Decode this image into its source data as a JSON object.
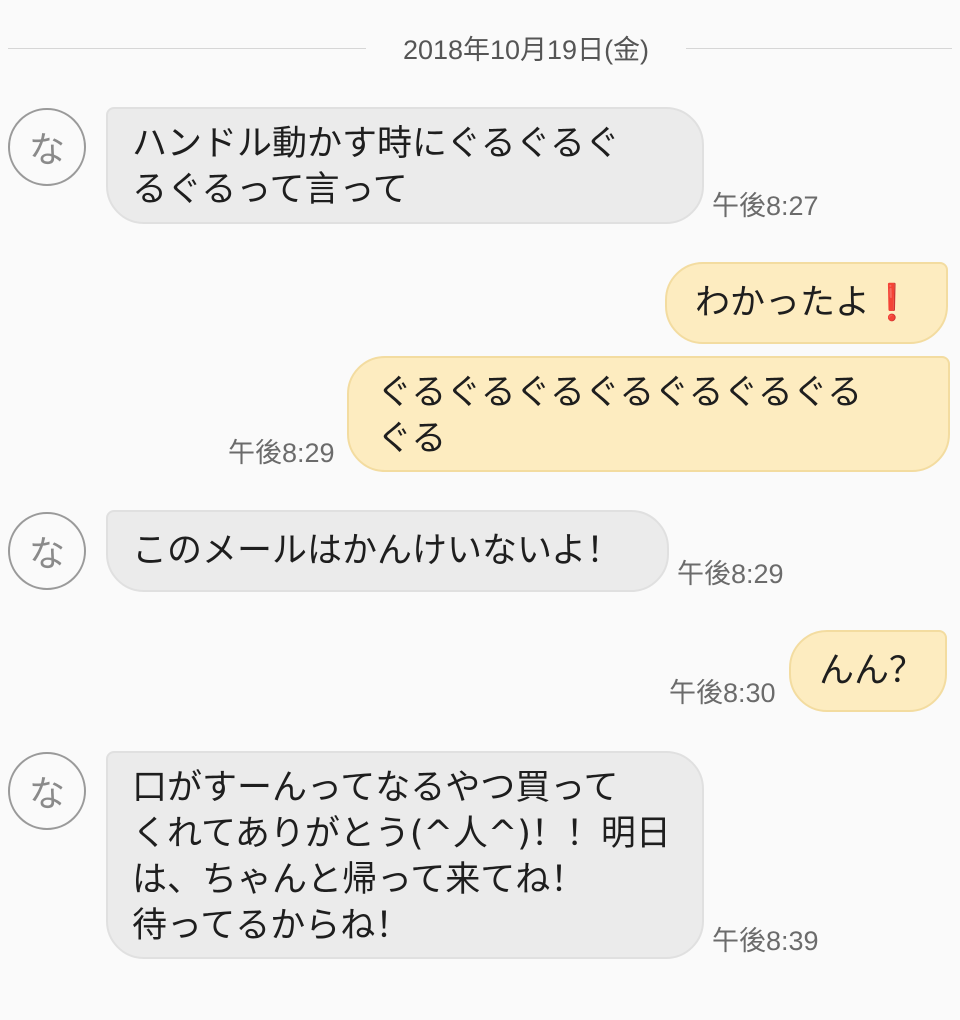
{
  "date_header": "2018年10月19日(金)",
  "avatar_label": "な",
  "messages": [
    {
      "side": "in",
      "lines": [
        "ハンドル動かす時にぐるぐるぐ",
        "るぐるって言って"
      ],
      "time": "午後8:27"
    },
    {
      "side": "out",
      "text": "わかったよ",
      "emoji": "❗"
    },
    {
      "side": "out",
      "lines": [
        "ぐるぐるぐるぐるぐるぐるぐる",
        "ぐる"
      ],
      "time": "午後8:29"
    },
    {
      "side": "in",
      "lines": [
        "このメールはかんけいないよ！"
      ],
      "time": "午後8:29"
    },
    {
      "side": "out",
      "lines": [
        "んん？"
      ],
      "time": "午後8:30"
    },
    {
      "side": "in",
      "lines": [
        "口がすーんってなるやつ買って",
        "くれてありがとう(^人^)！！明日",
        "は、ちゃんと帰って来てね！",
        "待ってるからね！"
      ],
      "time": "午後8:39"
    }
  ]
}
